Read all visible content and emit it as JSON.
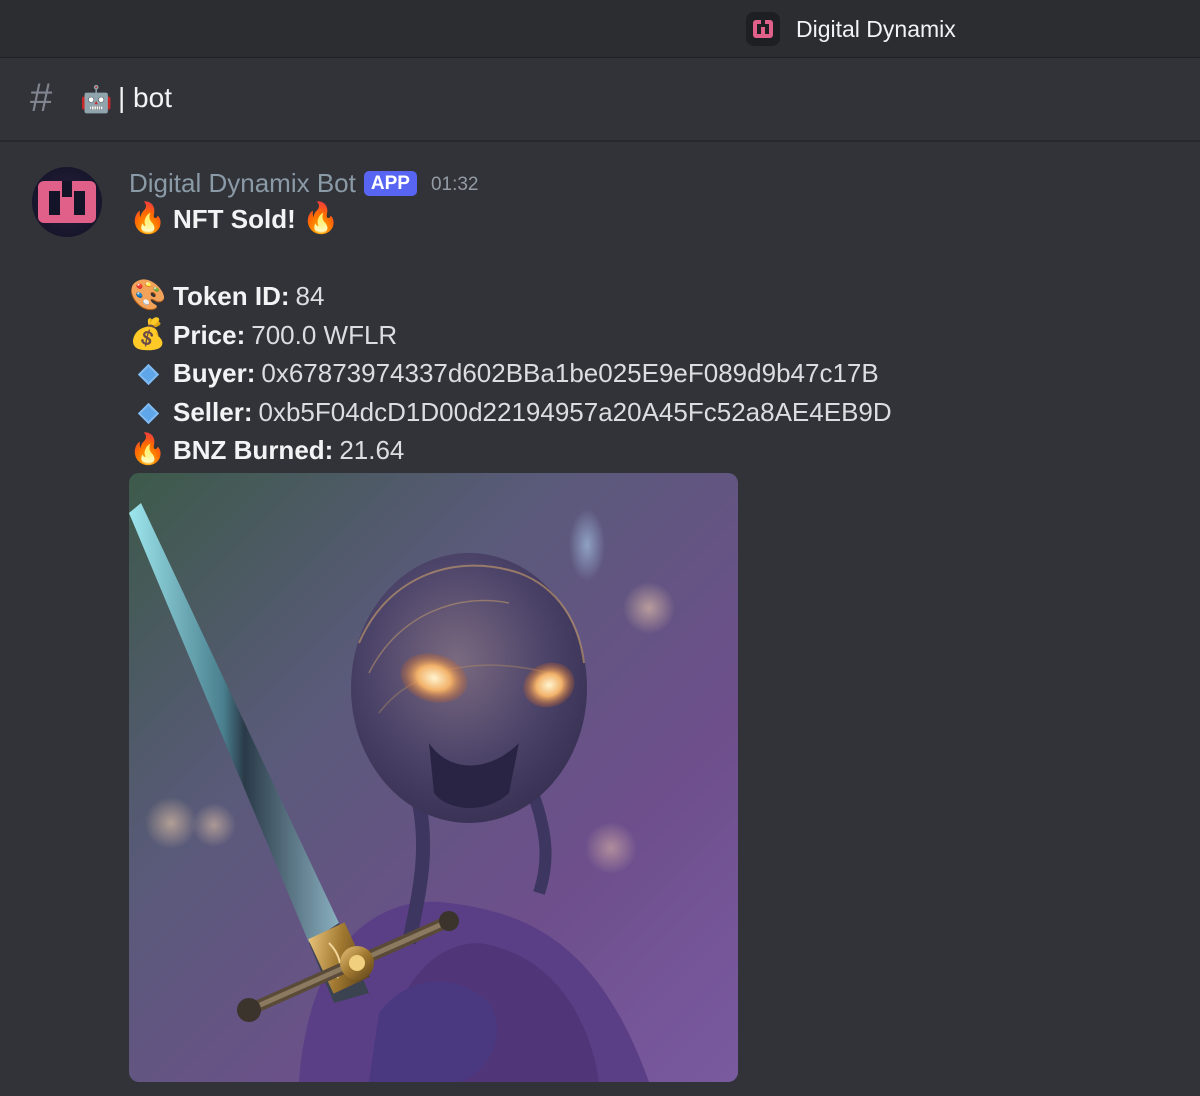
{
  "titlebar": {
    "server_name": "Digital Dynamix",
    "server_icon": "server-logo-icon"
  },
  "channel": {
    "hash": "#",
    "emoji": "🤖",
    "name": "| bot"
  },
  "message": {
    "author": "Digital Dynamix Bot",
    "badge": "APP",
    "timestamp": "01:32",
    "headline": {
      "left_emoji": "🔥",
      "text": "NFT Sold!",
      "right_emoji": "🔥"
    },
    "fields": [
      {
        "emoji": "🎨",
        "label": "Token ID:",
        "value": "84"
      },
      {
        "emoji": "💰",
        "label": "Price:",
        "value": "700.0 WFLR"
      },
      {
        "emoji": "🔷",
        "label": "Buyer:",
        "value": "0x67873974337d602BBa1be025E9eF089d9b47c17B"
      },
      {
        "emoji": "🔷",
        "label": "Seller:",
        "value": "0xb5F04dcD1D00d22194957a20A45Fc52a8AE4EB9D"
      },
      {
        "emoji": "🔥",
        "label": "BNZ Burned:",
        "value": "21.64"
      }
    ],
    "image": {
      "subject": "alien-with-sword-nft-artwork"
    }
  },
  "colors": {
    "background": "#313338",
    "titlebar": "#2b2d31",
    "app_badge": "#5865f2",
    "author": "#8a9aa6",
    "logo_pink": "#e0608a"
  }
}
